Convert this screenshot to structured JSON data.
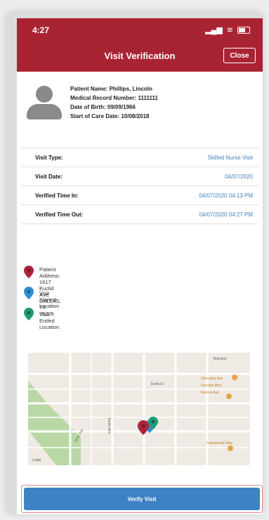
{
  "status_bar": {
    "time": "4:27",
    "signal": "▂▄▆"
  },
  "header": {
    "title": "Visit Verification",
    "close_label": "Close"
  },
  "patient": {
    "name": "Patient Name: Phillips, Lincoln",
    "mrn": "Medical Record Number: 1111111",
    "dob": "Date of Birth: 09/09/1966",
    "start_of_care": "Start of Care Date: 10/08/2018"
  },
  "details": [
    {
      "label": "Visit Type:",
      "value": "Skilled Nurse Visit"
    },
    {
      "label": "Visit Date:",
      "value": "04/07/2020"
    },
    {
      "label": "Verified Time In:",
      "value": "04/07/2020 04:13 PM"
    },
    {
      "label": "Verified Time Out:",
      "value": "04/07/2020 04:27 PM"
    }
  ],
  "legend": [
    {
      "text_line1": "Patient Address:",
      "text_line2": "1617 Euclid Ave, DALLAS, TX 75206",
      "color": "#b0243a"
    },
    {
      "text_line1": "Visit Started Location",
      "text_line2": "",
      "color": "#2c8fcf"
    },
    {
      "text_line1": "Visit Ended Location",
      "text_line2": "",
      "color": "#1f9a72"
    }
  ],
  "map": {
    "labels": [
      "Bellview",
      "Cherokee Ave",
      "Fiscales Blvd",
      "Renner Ave",
      "Smith Dr",
      "Dotts Ave",
      "Saulio Ave",
      "Carmencita Way"
    ],
    "credit": "Legal",
    "colors": {
      "base": "#efeae3",
      "park": "#b9d8a5",
      "road": "#ffffff",
      "poi": "#e8a24a"
    }
  },
  "verify_label": "Verify Visit",
  "colors": {
    "header": "#a92433",
    "link": "#3f7fc1",
    "button": "#3d82c4"
  }
}
